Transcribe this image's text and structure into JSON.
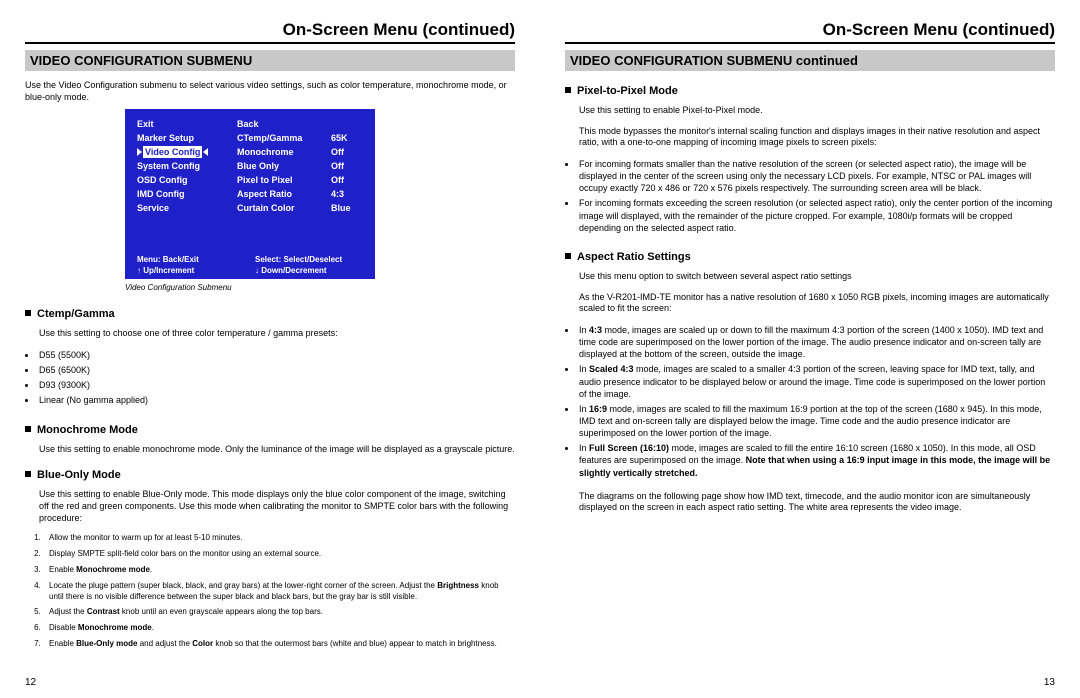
{
  "left": {
    "page_title": "On-Screen Menu (continued)",
    "section_head": "VIDEO CONFIGURATION SUBMENU",
    "intro": "Use the Video Configuration submenu to select various video settings, such as color temperature, monochrome mode, or blue-only mode.",
    "osd": {
      "rows": [
        {
          "left": "Exit",
          "mid": "Back",
          "right": ""
        },
        {
          "left": "Marker Setup",
          "mid": "CTemp/Gamma",
          "right": "65K"
        },
        {
          "left": "Video Config",
          "mid": "Monochrome",
          "right": "Off",
          "highlight": true
        },
        {
          "left": "System Config",
          "mid": "Blue Only",
          "right": "Off"
        },
        {
          "left": "OSD Config",
          "mid": "Pixel to Pixel",
          "right": "Off"
        },
        {
          "left": "IMD Config",
          "mid": "Aspect Ratio",
          "right": "4:3"
        },
        {
          "left": "Service",
          "mid": "Curtain Color",
          "right": "Blue"
        }
      ],
      "help": {
        "menu": "Menu: Back/Exit",
        "select": "Select: Select/Deselect",
        "up": "↑ Up/Increment",
        "down": "↓ Down/Decrement"
      },
      "caption": "Video Configuration Submenu"
    },
    "ctemp": {
      "head": "Ctemp/Gamma",
      "text": "Use this setting to choose one of three color temperature / gamma presets:",
      "items": [
        "D55 (5500K)",
        "D65 (6500K)",
        "D93 (9300K)",
        "Linear (No gamma applied)"
      ]
    },
    "mono": {
      "head": "Monochrome Mode",
      "text": "Use this setting to enable monochrome mode. Only the luminance of the image will be displayed as a grayscale picture."
    },
    "blue": {
      "head": "Blue-Only Mode",
      "text": "Use this setting to enable Blue-Only mode. This mode displays only the blue color component of the image, switching off the red and green components. Use this mode when calibrating the monitor to SMPTE color bars with the following procedure:",
      "steps": [
        {
          "t": "Allow the monitor to warm up for at least 5-10 minutes."
        },
        {
          "t": "Display SMPTE split-field color bars on the monitor using an external source."
        },
        {
          "pre": "Enable ",
          "bold": "Monochrome mode",
          "post": "."
        },
        {
          "pre": "Locate the pluge pattern (super black, black, and gray bars) at the lower-right corner of the screen. Adjust the ",
          "bold": "Brightness",
          "post": " knob until there is no visible difference between the super black and black bars, but the gray bar is still visible."
        },
        {
          "pre": "Adjust the ",
          "bold": "Contrast",
          "post": " knob until an even grayscale appears along the top bars."
        },
        {
          "pre": "Disable ",
          "bold": "Monochrome mode",
          "post": "."
        },
        {
          "pre": "Enable ",
          "bold": "Blue-Only mode",
          "mid": " and adjust the ",
          "bold2": "Color",
          "post": " knob so that the outermost bars (white and blue) appear to match in brightness."
        }
      ]
    },
    "page_num": "12"
  },
  "right": {
    "page_title": "On-Screen Menu (continued)",
    "section_head": "VIDEO CONFIGURATION SUBMENU continued",
    "p2p": {
      "head": "Pixel-to-Pixel Mode",
      "t1": "Use this setting to enable Pixel-to-Pixel mode.",
      "t2": "This mode bypasses the monitor's internal scaling function and displays images in their native resolution and aspect ratio, with a one-to-one mapping of incoming image pixels to screen pixels:",
      "items": [
        "For incoming formats smaller than the native resolution of the screen (or selected aspect ratio), the image will be displayed in the center of the screen using only the necessary LCD pixels. For example, NTSC or PAL images will occupy exactly 720 x 486 or 720 x 576 pixels respectively. The surrounding screen area will be black.",
        "For incoming formats exceeding the screen resolution (or selected aspect ratio), only the center portion of the incoming image will displayed, with the remainder of the picture cropped. For example, 1080i/p formats will be cropped depending on the selected aspect ratio."
      ]
    },
    "aspect": {
      "head": "Aspect Ratio Settings",
      "t1": "Use this menu option to switch between several aspect ratio settings",
      "t2": "As the V-R201-IMD-TE monitor has a native resolution of 1680 x 1050 RGB pixels, incoming images are automatically scaled to fit the screen:",
      "items": [
        {
          "pre": "In ",
          "bold": "4:3",
          "post": " mode, images are scaled up or down to fill the maximum 4:3 portion of the screen (1400 x 1050). IMD text and time code are superimposed on the lower portion of the image. The audio presence indicator and on-screen tally are displayed at the bottom of the screen, outside the image."
        },
        {
          "pre": "In ",
          "bold": "Scaled 4:3",
          "post": " mode, images are scaled to a smaller 4:3 portion of the screen, leaving space for IMD text, tally, and audio presence indicator to be displayed below or around the image. Time code is superimposed on the lower portion of the image."
        },
        {
          "pre": "In ",
          "bold": "16:9",
          "post": " mode, images are scaled to fill the maximum 16:9 portion at the top of the screen (1680 x 945). In this mode, IMD text and on-screen tally are displayed below the image. Time code and the audio presence indicator are superimposed on the lower portion of the image."
        },
        {
          "pre": "In ",
          "bold": "Full Screen (16:10)",
          "post": " mode, images are scaled to fill the entire 16:10 screen (1680 x 1050). In this mode, all OSD features are superimposed on the image. ",
          "bold2": "Note that when using a 16:9 input image in this mode, the image will be slightly vertically stretched."
        }
      ],
      "t3": "The diagrams on the following page show how IMD text, timecode, and the audio monitor icon are simultaneously displayed on the screen in each aspect ratio setting. The white area represents the video image."
    },
    "page_num": "13"
  }
}
